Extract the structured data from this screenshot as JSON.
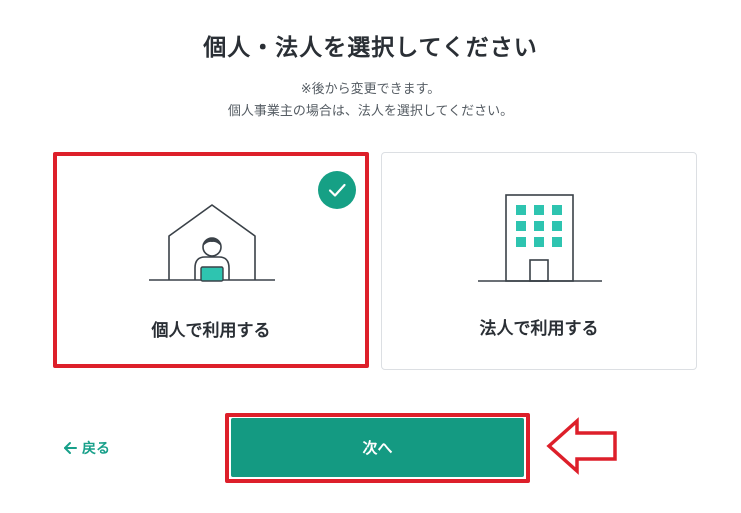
{
  "page": {
    "title": "個人・法人を選択してください",
    "note_line1": "※後から変更できます。",
    "note_line2": "個人事業主の場合は、法人を選択してください。"
  },
  "options": [
    {
      "id": "individual",
      "label": "個人で利用する",
      "selected": true,
      "icon": "house-person-icon"
    },
    {
      "id": "corporate",
      "label": "法人で利用する",
      "selected": false,
      "icon": "office-building-icon"
    }
  ],
  "nav": {
    "back_label": "戻る",
    "next_label": "次へ"
  },
  "colors": {
    "accent": "#149a82",
    "check_bg": "#16a085",
    "annotation_red": "#dd1f2a",
    "icon_teal": "#2ec4b0",
    "text_dark": "#2a2f35"
  }
}
